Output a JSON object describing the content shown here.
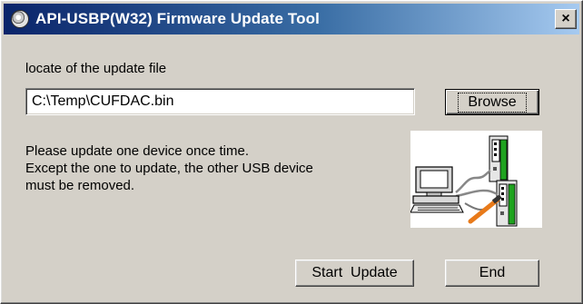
{
  "window": {
    "title": "API-USBP(W32) Firmware Update Tool",
    "close_label": "×"
  },
  "file_section": {
    "label": "locate of the update file",
    "path_value": "C:\\Temp\\CUFDAC.bin",
    "browse_label": "Browse"
  },
  "info": {
    "lines": [
      "Please update one device once time.",
      "Except the one to update, the other USB device",
      "must be removed."
    ]
  },
  "illustration": {
    "icon": "pc-to-usb-device-illustration"
  },
  "buttons": {
    "start_update_label": "Start  Update",
    "end_label": "End"
  }
}
